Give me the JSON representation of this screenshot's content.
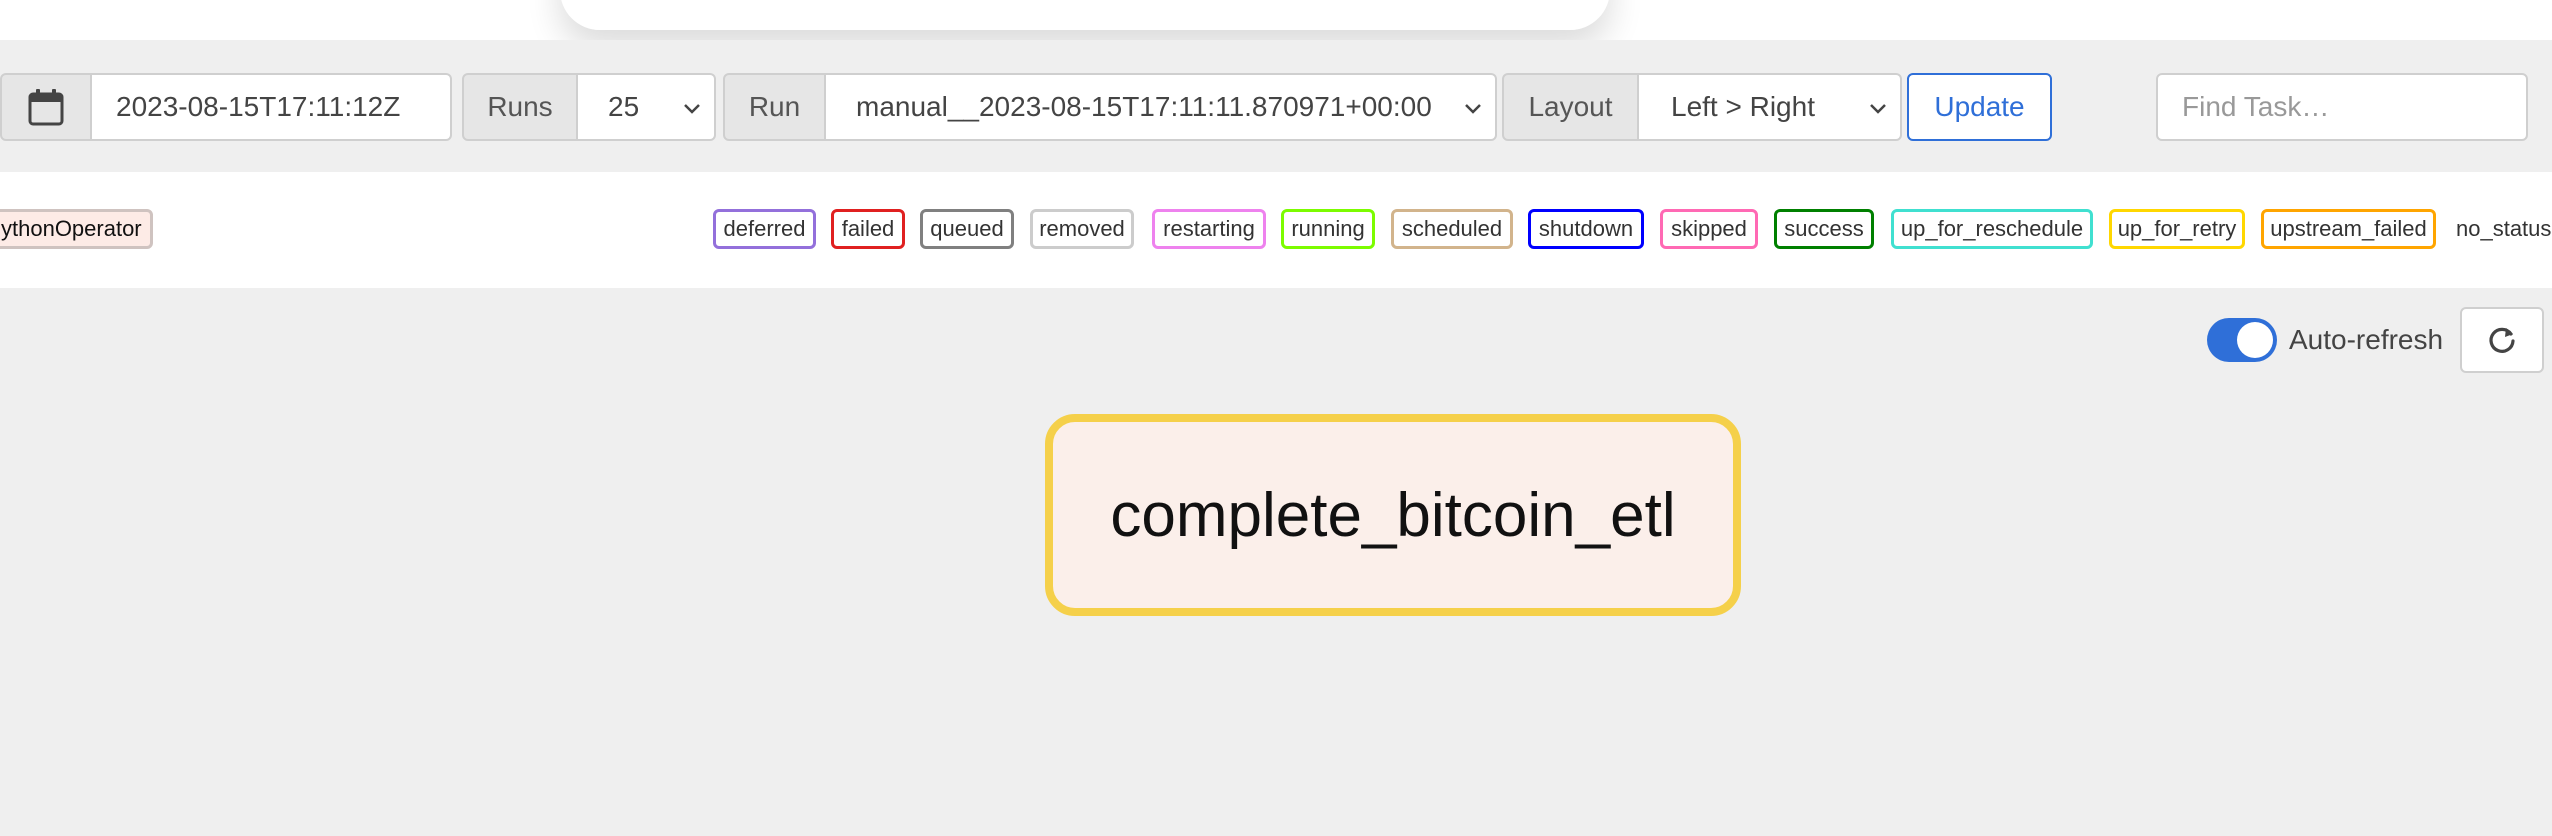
{
  "toolbar": {
    "calendar_icon": "calendar-icon",
    "base_date": "2023-08-15T17:11:12Z",
    "runs_label": "Runs",
    "runs_value": "25",
    "run_label": "Run",
    "run_value": "manual__2023-08-15T17:11:11.870971+00:00",
    "layout_label": "Layout",
    "layout_value": "Left > Right",
    "update_label": "Update",
    "find_task_placeholder": "Find Task…"
  },
  "legend": {
    "operator_label": "ythonOperator",
    "states": [
      {
        "label": "deferred",
        "color": "#9370db"
      },
      {
        "label": "failed",
        "color": "#e02020"
      },
      {
        "label": "queued",
        "color": "#808080"
      },
      {
        "label": "removed",
        "color": "#cccccc"
      },
      {
        "label": "restarting",
        "color": "#ee82ee"
      },
      {
        "label": "running",
        "color": "#7cfc00"
      },
      {
        "label": "scheduled",
        "color": "#d2b48c"
      },
      {
        "label": "shutdown",
        "color": "#0000ff"
      },
      {
        "label": "skipped",
        "color": "#ff69b4"
      },
      {
        "label": "success",
        "color": "#008000"
      },
      {
        "label": "up_for_reschedule",
        "color": "#40e0d0"
      },
      {
        "label": "up_for_retry",
        "color": "#ffd700"
      },
      {
        "label": "upstream_failed",
        "color": "#ffa500"
      }
    ],
    "no_status_label": "no_status"
  },
  "graph": {
    "auto_refresh_label": "Auto-refresh",
    "auto_refresh_on": true,
    "refresh_icon": "refresh-icon",
    "task_node_label": "complete_bitcoin_etl",
    "task_node_color": "#f5d04a"
  }
}
